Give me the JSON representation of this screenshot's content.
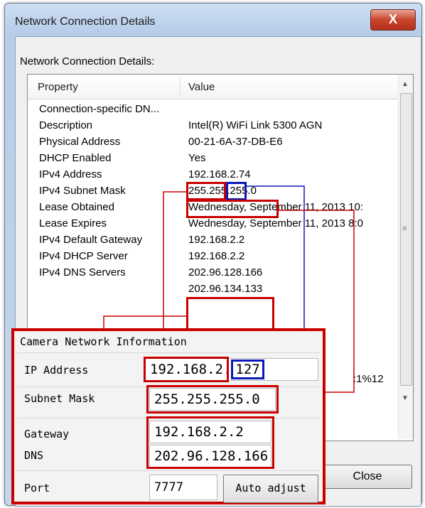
{
  "window": {
    "title": "Network Connection Details",
    "close_glyph": "X"
  },
  "dialog": {
    "caption": "Network Connection Details:",
    "columns": {
      "property": "Property",
      "value": "Value"
    },
    "rows": [
      {
        "property": "Connection-specific DN...",
        "value": ""
      },
      {
        "property": "Description",
        "value": "Intel(R) WiFi Link 5300 AGN"
      },
      {
        "property": "Physical Address",
        "value": "00-21-6A-37-DB-E6"
      },
      {
        "property": "DHCP Enabled",
        "value": "Yes"
      },
      {
        "property": "IPv4 Address",
        "value": "192.168.2.74"
      },
      {
        "property": "IPv4 Subnet Mask",
        "value": "255.255.255.0"
      },
      {
        "property": "Lease Obtained",
        "value": "Wednesday, September 11, 2013 10:"
      },
      {
        "property": "Lease Expires",
        "value": "Wednesday, September 11, 2013 8:0"
      },
      {
        "property": "IPv4 Default Gateway",
        "value": "192.168.2.2"
      },
      {
        "property": "IPv4 DHCP Server",
        "value": "192.168.2.2"
      },
      {
        "property": "IPv4 DNS Servers",
        "value": "202.96.128.166"
      },
      {
        "property": "",
        "value": "202.96.134.133"
      }
    ],
    "partial_value": ":1%12",
    "close_button": "Close"
  },
  "camera": {
    "title": "Camera Network Information",
    "ip_label": "IP Address",
    "ip_prefix": "192.168.2.",
    "ip_suffix": "127",
    "subnet_label": "Subnet Mask",
    "subnet_value": "255.255.255.0",
    "gateway_label": "Gateway",
    "gateway_value": "192.168.2.2",
    "dns_label": "DNS",
    "dns_value": "202.96.128.166",
    "port_label": "Port",
    "port_value": "7777",
    "auto_adjust": "Auto adjust"
  },
  "colors": {
    "highlight_red": "#c90000",
    "highlight_blue": "#0b19b8"
  },
  "icons": {
    "scroll_up": "chevron-up",
    "scroll_down": "chevron-down",
    "scroll_right": "chevron-right",
    "grip": "scroll-grip"
  }
}
